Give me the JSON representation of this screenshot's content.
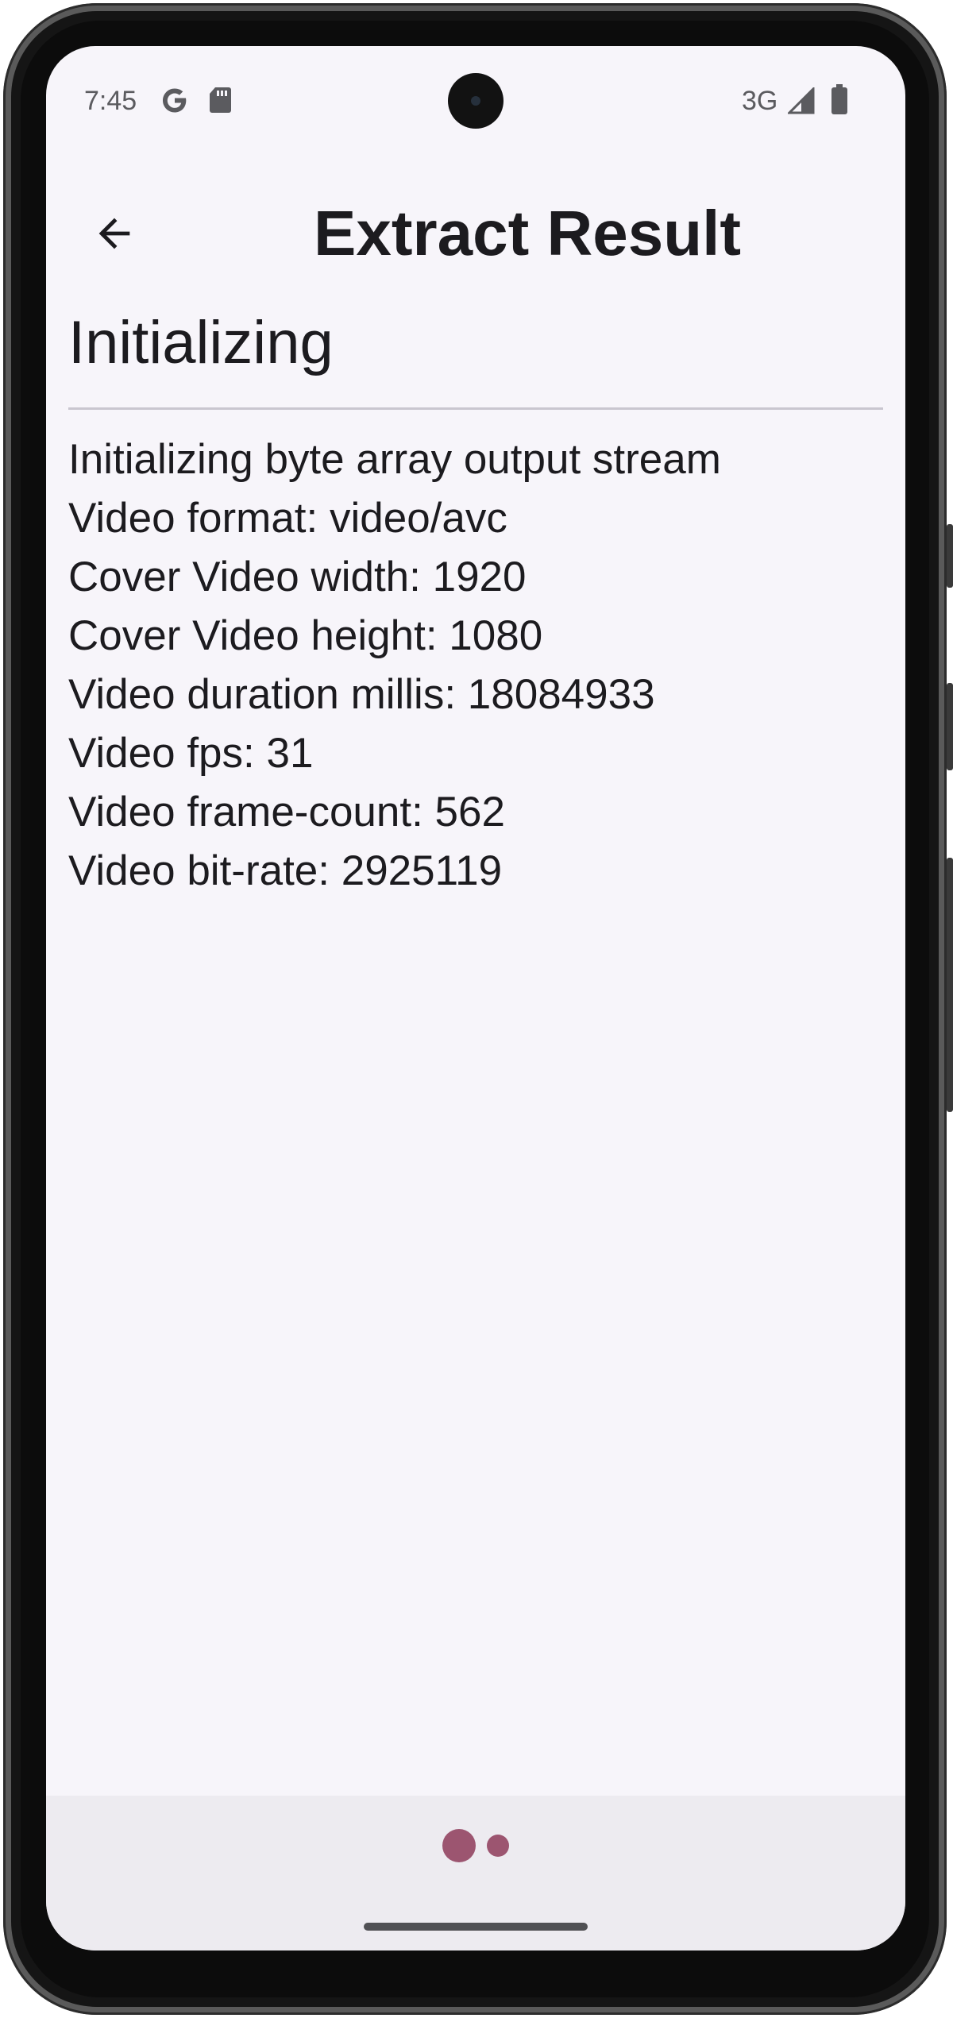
{
  "status_bar": {
    "time": "7:45",
    "network": "3G",
    "icons": [
      "google-icon",
      "sd-card-icon",
      "signal-icon",
      "battery-icon"
    ]
  },
  "app_bar": {
    "back_icon": "arrow-back-icon",
    "title": "Extract Result"
  },
  "main": {
    "heading": "Initializing",
    "log_lines": [
      "Initializing byte array output stream",
      "Video format: video/avc",
      "Cover Video width: 1920",
      "Cover Video height: 1080",
      "Video duration millis: 18084933",
      "Video fps: 31",
      "Video frame-count: 562",
      "Video bit-rate: 2925119"
    ]
  },
  "colors": {
    "background": "#f7f5fa",
    "text": "#1c1b1f",
    "accent": "#9c5570",
    "bottom_bar": "#edebf0"
  }
}
